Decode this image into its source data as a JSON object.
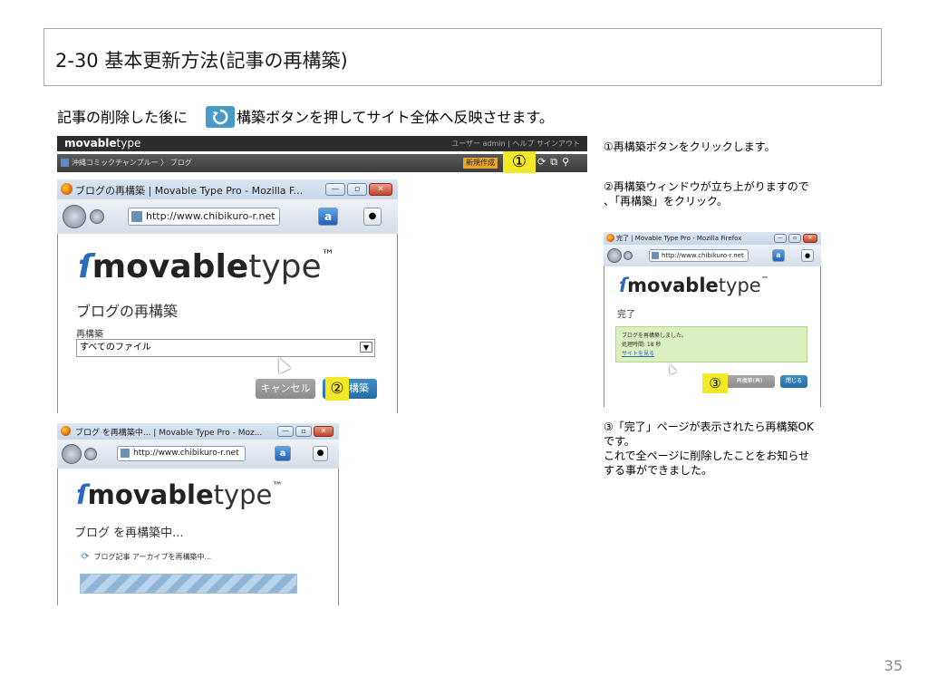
{
  "title": "2-30 基本更新方法(記事の再構築)",
  "intro": {
    "before": "記事の削除した後に",
    "after": "構築ボタンを押してサイト全体へ反映させます。"
  },
  "mt_header": {
    "logo_bold": "movable",
    "logo_light": "type",
    "user_area": "ユーザー  admin | ヘルプ  サインアウト",
    "breadcrumb_blog": "沖縄コミックチャンプルー",
    "breadcrumb_page": "ブログ",
    "new_button": "新規作成",
    "marker": "①"
  },
  "rebuild_window": {
    "title": "ブログの再構築 | Movable Type Pro - Mozilla F...",
    "url": "http://www.chibikuro-r.net",
    "brand_bold": "movable",
    "brand_light": "type",
    "heading": "ブログの再構築",
    "select_label": "再構築",
    "select_value": "すべてのファイル",
    "cancel_label": "キャンセル",
    "rebuild_label": "構築",
    "marker": "②"
  },
  "progress_window": {
    "title": "ブログ を再構築中... | Movable Type Pro - Moz...",
    "url": "http://www.chibikuro-r.net",
    "brand_bold": "movable",
    "brand_light": "type",
    "heading": "ブログ を再構築中...",
    "status": "ブログ記事 アーカイブを再構築中..."
  },
  "complete_window": {
    "title": "完了 | Movable Type Pro - Mozilla Firefox",
    "url": "http://www.chibikuro-r.net",
    "brand_bold": "movable",
    "brand_light": "type",
    "heading": "完了",
    "done_line1": "ブログを再構築しました。",
    "done_line2": "処理時間: 18 秒",
    "done_link": "サイトを見る",
    "btn_again": "再構築(再)",
    "btn_close": "閉じる",
    "marker": "③"
  },
  "steps": {
    "step1": "①再構築ボタンをクリックします。",
    "step2_line1": "②再構築ウィンドウが立ち上がりますので",
    "step2_line2": "、「再構築」をクリック。",
    "step3_line1": "③「完了」ページが表示されたら再構築OK",
    "step3_line2": "です。",
    "step3_line3": "これで全ページに削除したことをお知らせ",
    "step3_line4": "する事ができました。"
  },
  "page_number": "35",
  "colors": {
    "highlight": "#f3e928",
    "rebuild_blue": "#246ea2",
    "done_green": "#dcefc0",
    "refresh_icon": "#4a9ac8"
  },
  "icons": [
    "refresh-icon",
    "firefox-icon",
    "globe-icon",
    "cursor-icon",
    "sync-spinner-icon"
  ]
}
